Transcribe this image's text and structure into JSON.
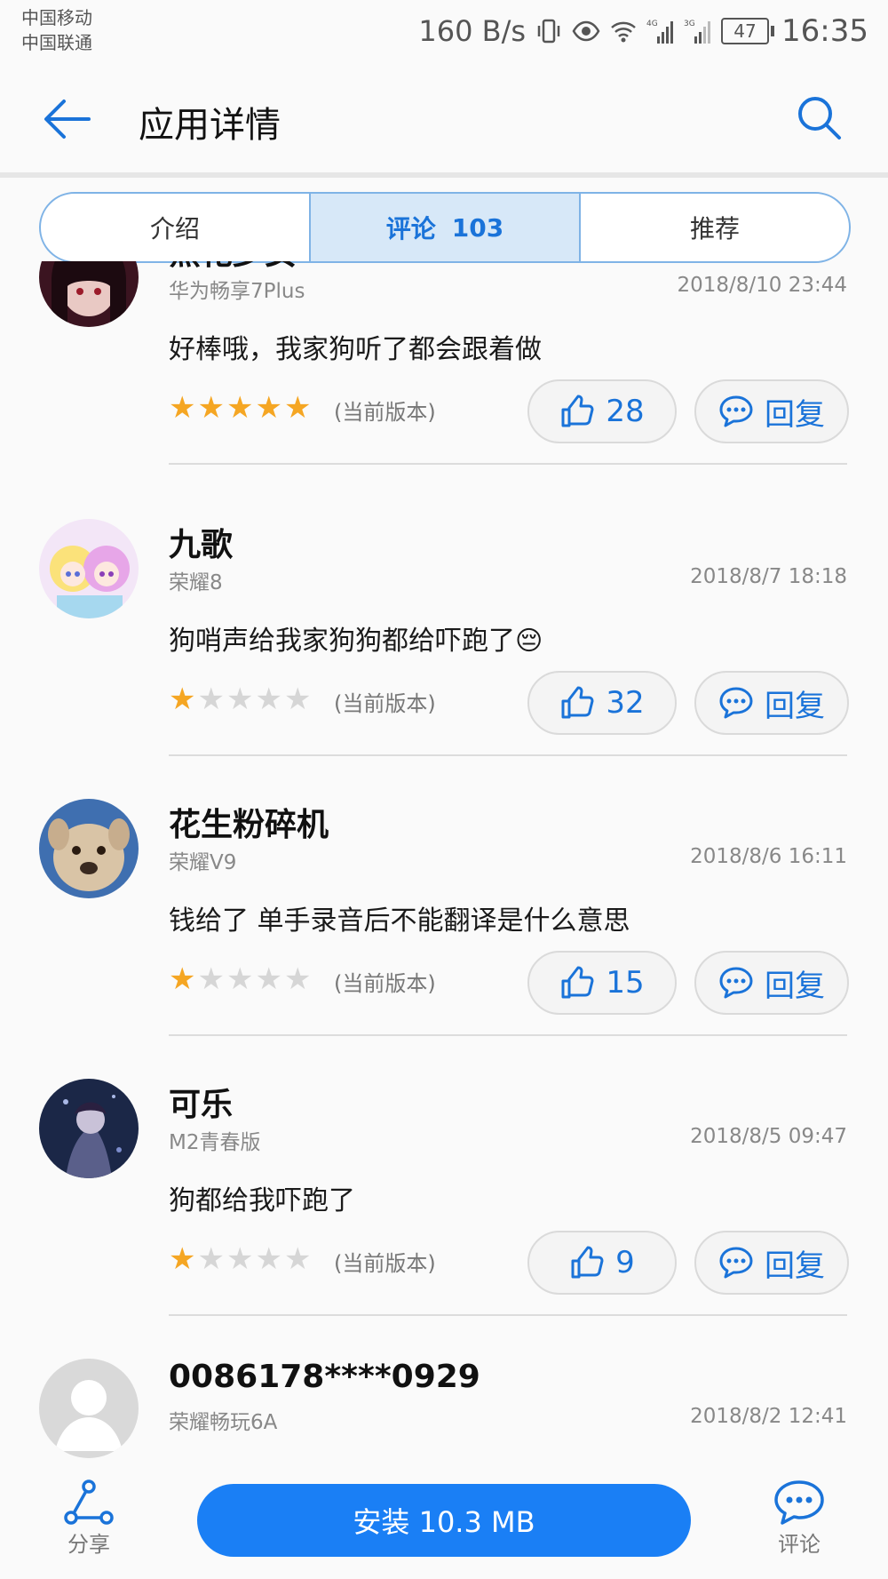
{
  "status_bar": {
    "carrier_1": "中国移动",
    "carrier_2": "中国联通",
    "net_speed": "160 B/s",
    "net_4g": "4G",
    "net_3g": "3G",
    "battery": "47",
    "time": "16:35"
  },
  "header": {
    "title": "应用详情"
  },
  "tabs": [
    {
      "label": "介绍",
      "count": ""
    },
    {
      "label": "评论",
      "count": "103"
    },
    {
      "label": "推荐",
      "count": ""
    }
  ],
  "reviews": [
    {
      "name": "黑化少女",
      "device": "华为畅享7Plus",
      "date": "2018/8/10 23:44",
      "content": "好棒哦，我家狗听了都会跟着做",
      "rating": 5,
      "version": "(当前版本)",
      "likes": "28",
      "reply_label": "回复"
    },
    {
      "name": "九歌",
      "device": "荣耀8",
      "date": "2018/8/7 18:18",
      "content": "狗哨声给我家狗狗都给吓跑了😔",
      "rating": 1,
      "version": "(当前版本)",
      "likes": "32",
      "reply_label": "回复"
    },
    {
      "name": "花生粉碎机",
      "device": "荣耀V9",
      "date": "2018/8/6 16:11",
      "content": "钱给了  单手录音后不能翻译是什么意思",
      "rating": 1,
      "version": "(当前版本)",
      "likes": "15",
      "reply_label": "回复"
    },
    {
      "name": "可乐",
      "device": "M2青春版",
      "date": "2018/8/5 09:47",
      "content": "狗都给我吓跑了",
      "rating": 1,
      "version": "(当前版本)",
      "likes": "9",
      "reply_label": "回复"
    },
    {
      "name": "0086178****0929",
      "device": "荣耀畅玩6A",
      "date": "2018/8/2 12:41",
      "content": "",
      "rating": 0,
      "version": "",
      "likes": "",
      "reply_label": ""
    }
  ],
  "bottom_bar": {
    "share_label": "分享",
    "install_label": "安装 10.3 MB",
    "comment_label": "评论"
  },
  "colors": {
    "accent": "#1a73d9",
    "install_button": "#1a7ff5",
    "star_on": "#f5a623",
    "star_off": "#d6d6d6"
  },
  "icons": [
    "back-arrow-icon",
    "search-icon",
    "thumbs-up-icon",
    "chat-bubble-icon",
    "share-icon",
    "comment-icon"
  ]
}
